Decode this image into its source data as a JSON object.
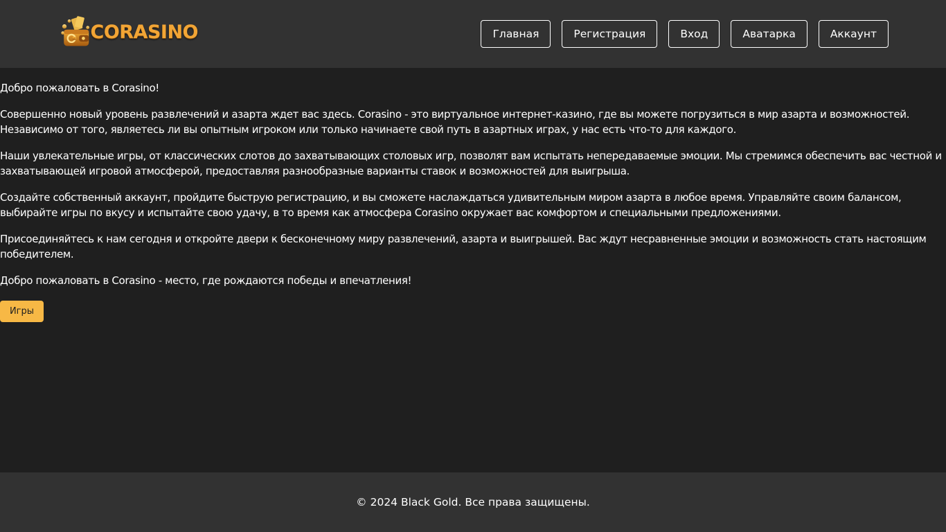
{
  "brand": {
    "name": "CORASINO",
    "logo_icon": "wallet-coins-icon",
    "color": "#f2a535"
  },
  "nav": {
    "items": [
      {
        "label": "Главная"
      },
      {
        "label": "Регистрация"
      },
      {
        "label": "Вход"
      },
      {
        "label": "Аватарка"
      },
      {
        "label": "Аккаунт"
      }
    ]
  },
  "main": {
    "paragraphs": [
      "Добро пожаловать в Corasino!",
      "Совершенно новый уровень развлечений и азарта ждет вас здесь. Corasino - это виртуальное интернет-казино, где вы можете погрузиться в мир азарта и возможностей. Независимо от того, являетесь ли вы опытным игроком или только начинаете свой путь в азартных играх, у нас есть что-то для каждого.",
      "Наши увлекательные игры, от классических слотов до захватывающих столовых игр, позволят вам испытать непередаваемые эмоции. Мы стремимся обеспечить вас честной и захватывающей игровой атмосферой, предоставляя разнообразные варианты ставок и возможностей для выигрыша.",
      "Создайте собственный аккаунт, пройдите быструю регистрацию, и вы сможете наслаждаться удивительным миром азарта в любое время. Управляйте своим балансом, выбирайте игры по вкусу и испытайте свою удачу, в то время как атмосфера Corasino окружает вас комфортом и специальными предложениями.",
      "Присоединяйтесь к нам сегодня и откройте двери к бесконечному миру развлечений, азарта и выигрышей. Вас ждут несравненные эмоции и возможность стать настоящим победителем.",
      "Добро пожаловать в Corasino - место, где рождаются победы и впечатления!"
    ],
    "games_button": "Игры",
    "accent_color": "#f7b845"
  },
  "footer": {
    "text": "© 2024 Black Gold. Все права защищены."
  },
  "colors": {
    "header_bg": "#323232",
    "page_bg": "#1f1f1f",
    "text": "#ffffff"
  }
}
